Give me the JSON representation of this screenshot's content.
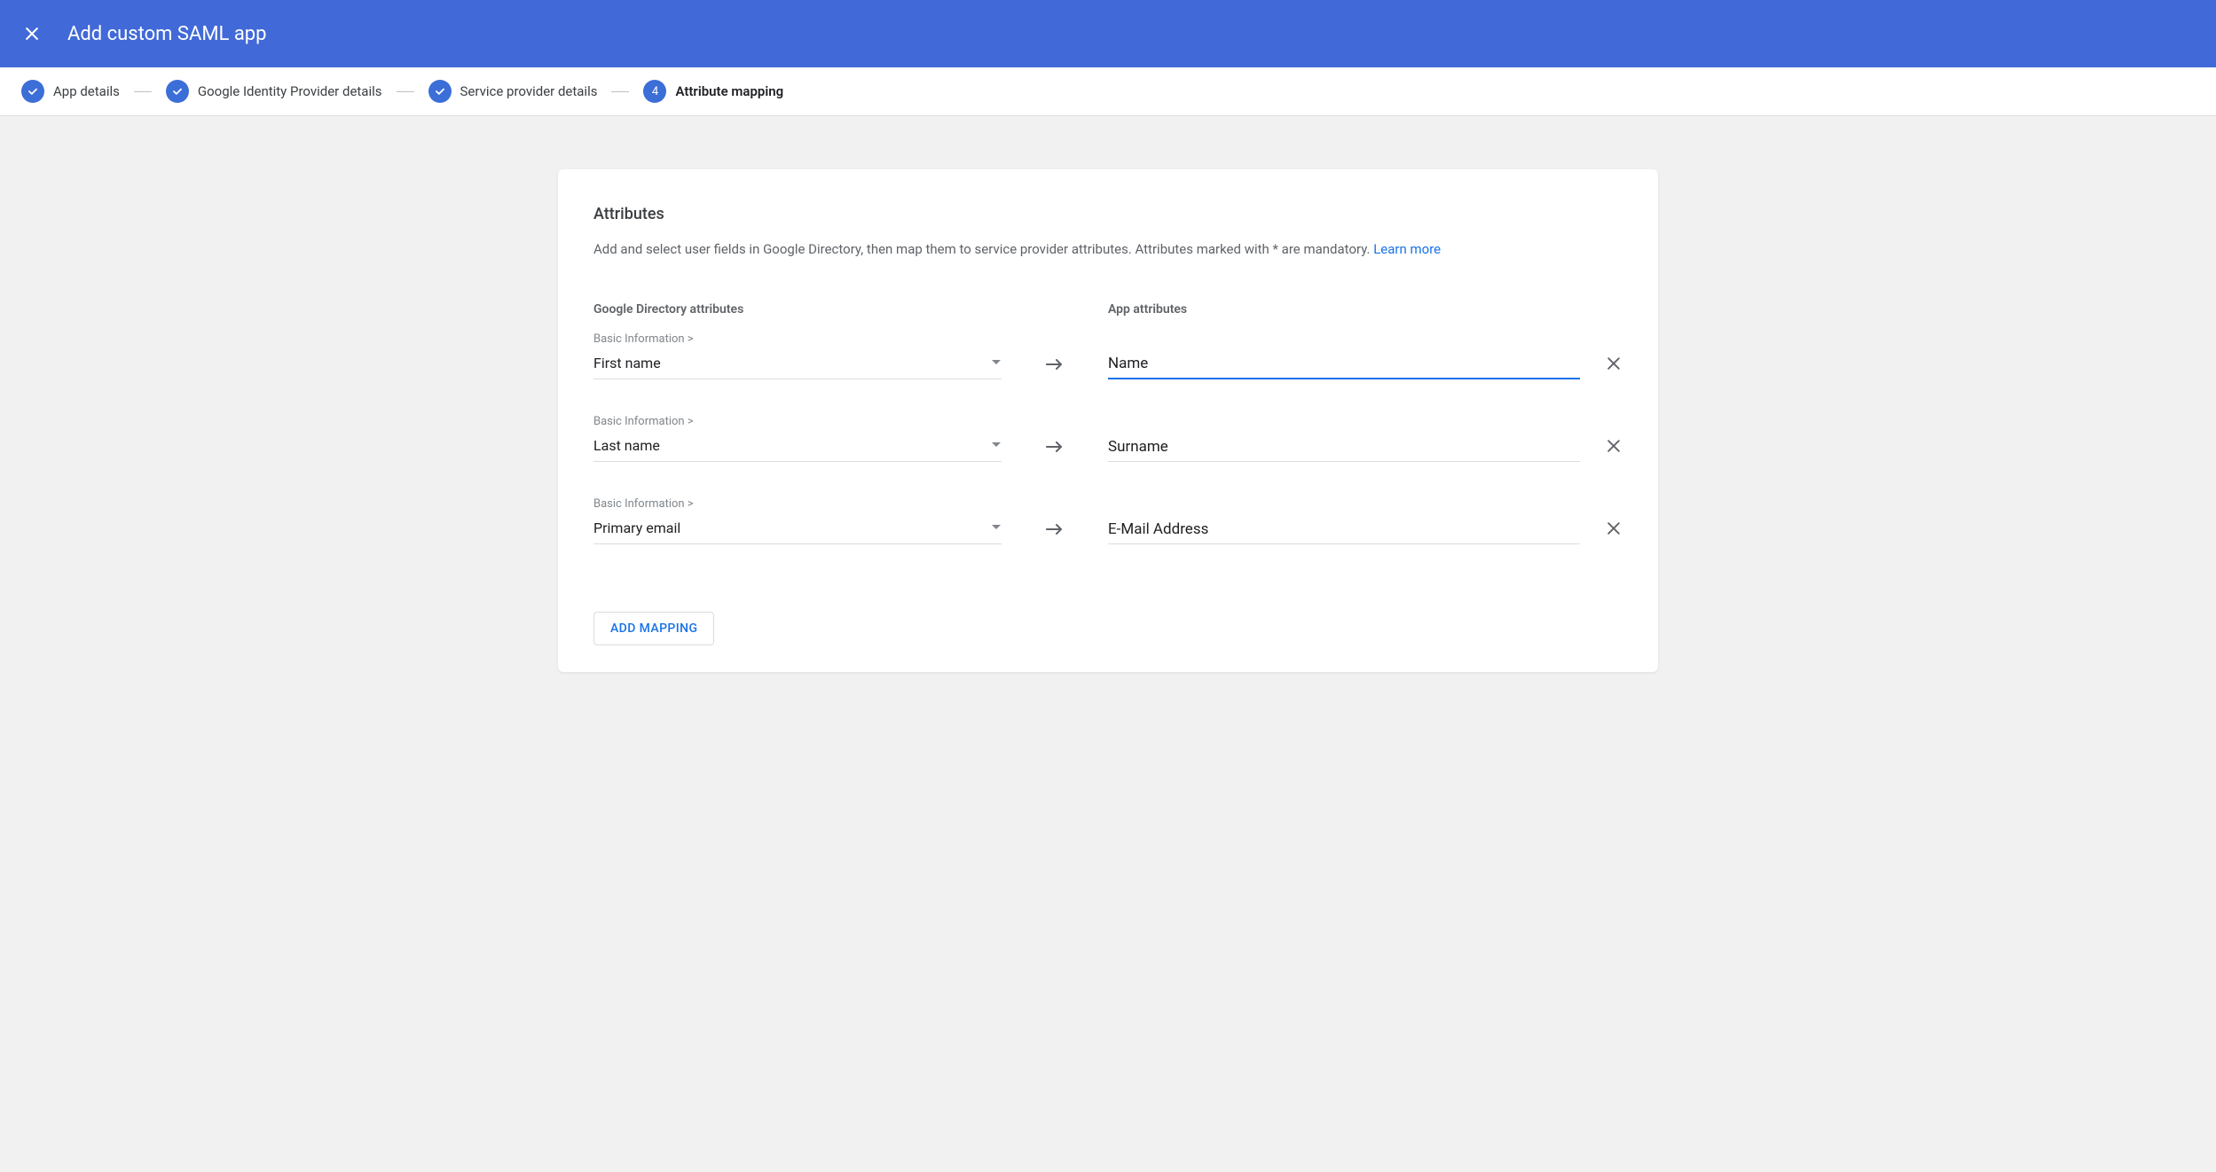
{
  "header": {
    "title": "Add custom SAML app"
  },
  "steps": [
    {
      "label": "App details",
      "state": "done"
    },
    {
      "label": "Google Identity Provider details",
      "state": "done"
    },
    {
      "label": "Service provider details",
      "state": "done"
    },
    {
      "label": "Attribute mapping",
      "state": "active",
      "number": "4"
    }
  ],
  "panel": {
    "heading": "Attributes",
    "description_text": "Add and select user fields in Google Directory, then map them to service provider attributes. Attributes marked with * are mandatory. ",
    "learn_more": "Learn more",
    "left_col_title": "Google Directory attributes",
    "right_col_title": "App attributes",
    "add_mapping_label": "ADD MAPPING"
  },
  "mappings": [
    {
      "category": "Basic Information >",
      "directory_value": "First name",
      "app_value": "Name",
      "focused": true
    },
    {
      "category": "Basic Information >",
      "directory_value": "Last name",
      "app_value": "Surname",
      "focused": false
    },
    {
      "category": "Basic Information >",
      "directory_value": "Primary email",
      "app_value": "E-Mail Address",
      "focused": false
    }
  ]
}
